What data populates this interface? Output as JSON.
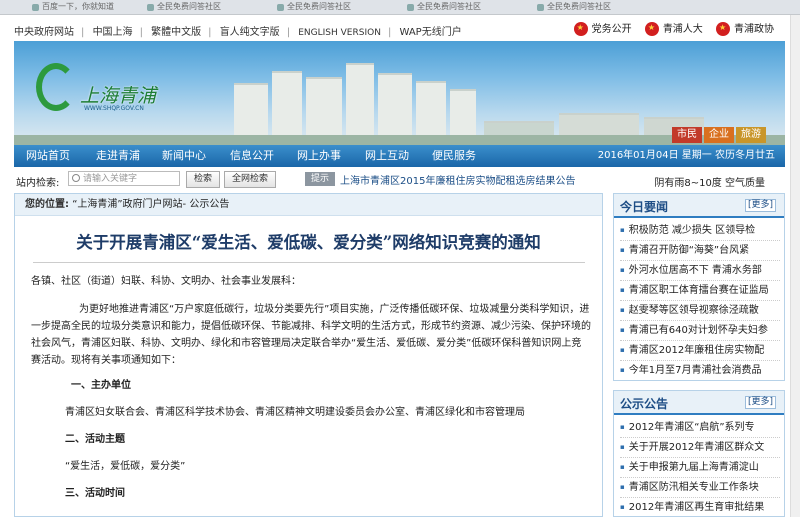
{
  "browser": {
    "tabs": [
      "百度一下，你就知道",
      "全民免费问答社区",
      "全民免费问答社区",
      "全民免费问答社区",
      "全民免费问答社区"
    ]
  },
  "topbar": {
    "links": [
      "中央政府网站",
      "中国上海",
      "繁體中文版",
      "盲人纯文字版",
      "ENGLISH VERSION",
      "WAP无线门户"
    ],
    "right_links": [
      "党务公开",
      "青浦人大",
      "青浦政协"
    ]
  },
  "banner": {
    "logo_text": "上海青浦",
    "logo_url": "WWW.SHQP.GOV.CN",
    "tags": [
      "市民",
      "企业",
      "旅游"
    ]
  },
  "nav": {
    "items": [
      "网站首页",
      "走进青浦",
      "新闻中心",
      "信息公开",
      "网上办事",
      "网上互动",
      "便民服务"
    ],
    "date": "2016年01月04日 星期一  农历冬月廿五"
  },
  "search": {
    "label": "站内检索:",
    "placeholder": "请输入关键字",
    "btn_search": "检索",
    "btn_full": "全网检索",
    "tip": "提示",
    "marquee": "上海市青浦区2015年廉租住房实物配租选房结果公告",
    "weather": "阴有雨8~10度  空气质量"
  },
  "article": {
    "crumb_label": "您的位置:",
    "crumb": "“上海青浦”政府门户网站- 公示公告",
    "title": "关于开展青浦区“爱生活、爱低碳、爱分类”网络知识竞赛的通知",
    "salutation": "各镇、社区（街道）妇联、科协、文明办、社会事业发展科：",
    "body": "为更好地推进青浦区“万户家庭低碳行，垃圾分类要先行”项目实施，广泛传播低碳环保、垃圾减量分类科学知识，进一步提高全民的垃圾分类意识和能力，提倡低碳环保、节能减排、科学文明的生活方式，形成节约资源、减少污染、保护环境的社会风气，青浦区妇联、科协、文明办、绿化和市容管理局决定联合举办“爱生活、爱低碳、爱分类”低碳环保科普知识网上竞赛活动。现将有关事项通知如下：",
    "h1": "一、主办单位",
    "h1_text": "青浦区妇女联合会、青浦区科学技术协会、青浦区精神文明建设委员会办公室、青浦区绿化和市容管理局",
    "h2": "二、活动主题",
    "h2_text": "“爱生活，爱低碳，爱分类”",
    "h3": "三、活动时间"
  },
  "sidebar": {
    "today": {
      "title": "今日要闻",
      "more": "[更多]",
      "items": [
        "积极防范 减少损失 区领导检",
        "青浦召开防御“海葵”台风紧",
        "外河水位居高不下 青浦水务部",
        "青浦区职工体育擂台赛在证监局",
        "赵雯琴等区领导视察徐泾疏散",
        "青浦已有640对计划怀孕夫妇参",
        "青浦区2012年廉租住房实物配",
        "今年1月至7月青浦社会消费品"
      ]
    },
    "notice": {
      "title": "公示公告",
      "more": "[更多]",
      "items": [
        "2012年青浦区“启航”系列专",
        "关于开展2012年青浦区群众文",
        "关于申报第九届上海青浦淀山",
        "青浦区防汛相关专业工作条块",
        "2012年青浦区再生育审批结果"
      ]
    }
  }
}
